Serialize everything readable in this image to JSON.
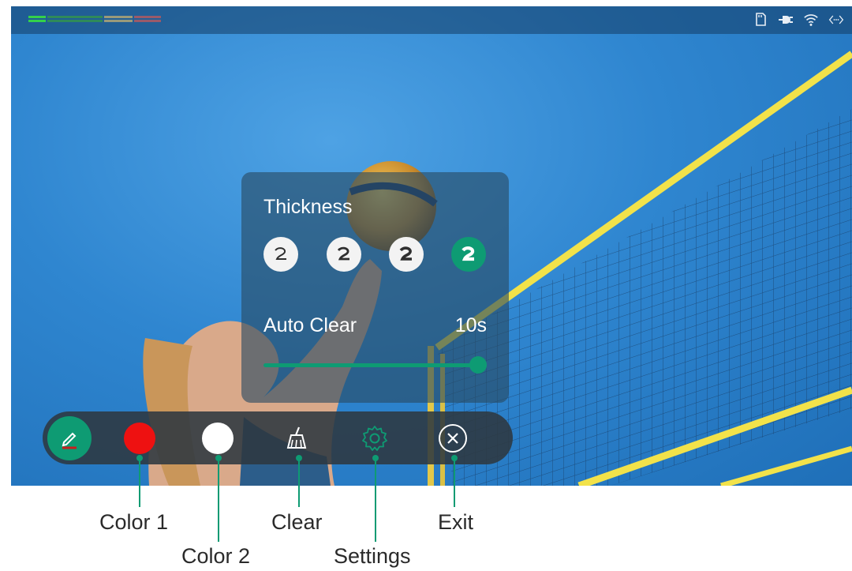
{
  "status_bar": {
    "icons": [
      "sd-card-icon",
      "power-plug-icon",
      "wifi-icon",
      "network-arrows-icon"
    ]
  },
  "settings_panel": {
    "thickness_label": "Thickness",
    "thickness_options": [
      "thin",
      "medium",
      "thick",
      "extra-thick"
    ],
    "thickness_selected_index": 3,
    "auto_clear_label": "Auto Clear",
    "auto_clear_value": "10s",
    "auto_clear_slider_fraction": 1.0
  },
  "toolbar": {
    "tools": [
      "pen",
      "color1",
      "color2",
      "clear",
      "settings",
      "exit"
    ],
    "color1": "#ee1111",
    "color2": "#ffffff",
    "accent": "#0e9b73"
  },
  "callouts": {
    "color1": "Color 1",
    "color2": "Color 2",
    "clear": "Clear",
    "settings": "Settings",
    "exit": "Exit"
  }
}
